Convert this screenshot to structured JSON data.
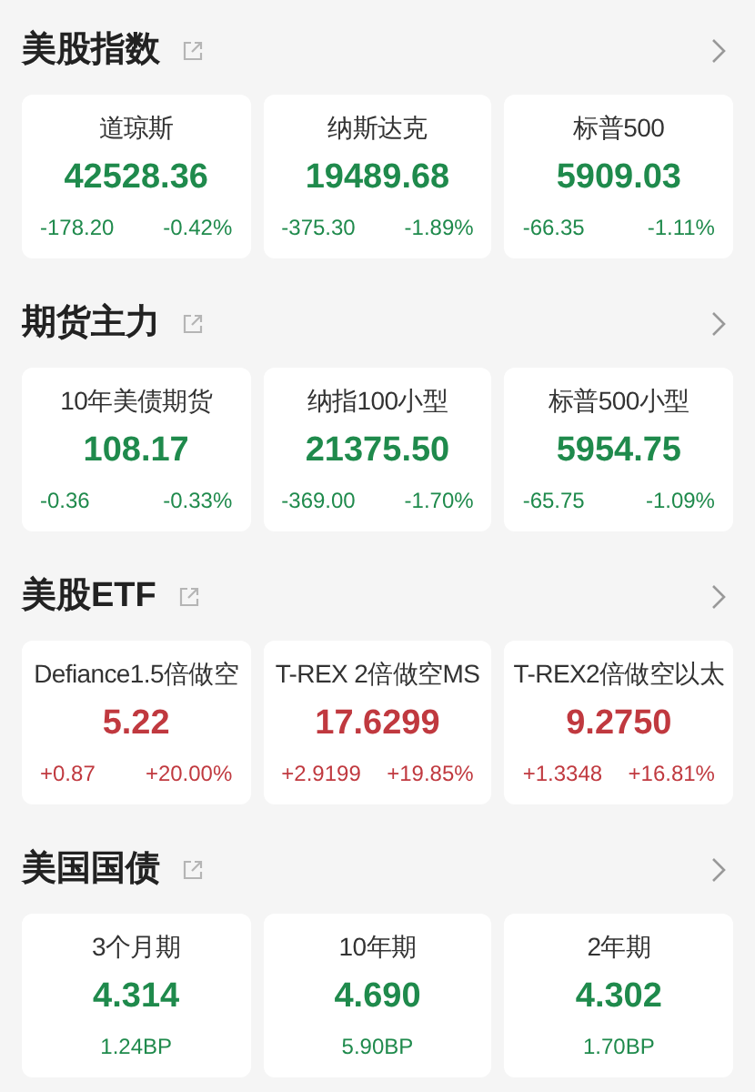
{
  "sections": [
    {
      "title": "美股指数",
      "cards": [
        {
          "name": "道琼斯",
          "price": "42528.36",
          "color": "#1f8a4c",
          "changes": [
            "-178.20",
            "-0.42%"
          ]
        },
        {
          "name": "纳斯达克",
          "price": "19489.68",
          "color": "#1f8a4c",
          "changes": [
            "-375.30",
            "-1.89%"
          ]
        },
        {
          "name": "标普500",
          "price": "5909.03",
          "color": "#1f8a4c",
          "changes": [
            "-66.35",
            "-1.11%"
          ]
        }
      ]
    },
    {
      "title": "期货主力",
      "cards": [
        {
          "name": "10年美债期货",
          "price": "108.17",
          "color": "#1f8a4c",
          "changes": [
            "-0.36",
            "-0.33%"
          ]
        },
        {
          "name": "纳指100小型",
          "price": "21375.50",
          "color": "#1f8a4c",
          "changes": [
            "-369.00",
            "-1.70%"
          ]
        },
        {
          "name": "标普500小型",
          "price": "5954.75",
          "color": "#1f8a4c",
          "changes": [
            "-65.75",
            "-1.09%"
          ]
        }
      ]
    },
    {
      "title": "美股ETF",
      "cards": [
        {
          "name": "Defiance1.5倍做空",
          "price": "5.22",
          "color": "#c0393f",
          "changes": [
            "+0.87",
            "+20.00%"
          ]
        },
        {
          "name": "T-REX 2倍做空MS",
          "price": "17.6299",
          "color": "#c0393f",
          "changes": [
            "+2.9199",
            "+19.85%"
          ]
        },
        {
          "name": "T-REX2倍做空以太",
          "price": "9.2750",
          "color": "#c0393f",
          "changes": [
            "+1.3348",
            "+16.81%"
          ]
        }
      ]
    },
    {
      "title": "美国国债",
      "cards": [
        {
          "name": "3个月期",
          "price": "4.314",
          "color": "#1f8a4c",
          "changes": [
            "1.24BP"
          ]
        },
        {
          "name": "10年期",
          "price": "4.690",
          "color": "#1f8a4c",
          "changes": [
            "5.90BP"
          ]
        },
        {
          "name": "2年期",
          "price": "4.302",
          "color": "#1f8a4c",
          "changes": [
            "1.70BP"
          ]
        }
      ]
    }
  ]
}
